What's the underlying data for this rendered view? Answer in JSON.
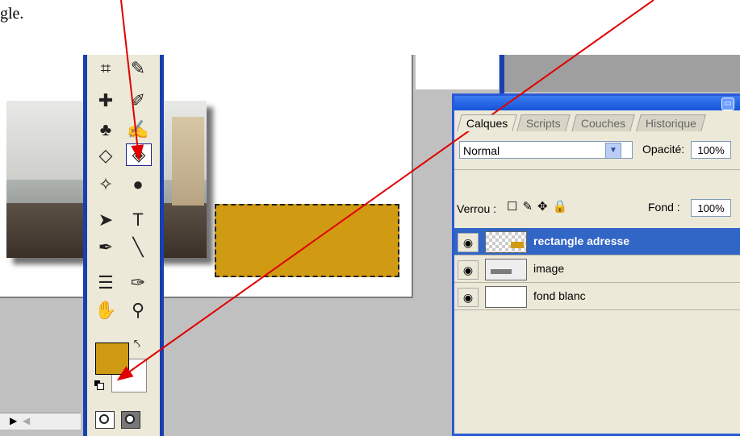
{
  "intro_text": "gle.",
  "colors": {
    "foreground": "#d09a12",
    "background": "#ffffff",
    "panel_blue": "#2a5ad7",
    "selected_layer": "#3165c6",
    "annotation_arrow": "#e00000"
  },
  "toolbox": {
    "tools": [
      "crop-icon",
      "slice-icon",
      "healing-brush-icon",
      "brush-icon",
      "clone-stamp-icon",
      "history-brush-icon",
      "eraser-icon",
      "paint-bucket-icon",
      "blur-icon",
      "dodge-icon",
      "path-selection-icon",
      "type-icon",
      "pen-icon",
      "line-icon",
      "notes-icon",
      "eyedropper-icon",
      "hand-icon",
      "zoom-icon"
    ],
    "active_tool": "paint-bucket-icon",
    "type_tool_glyph": "T"
  },
  "layers_panel": {
    "tabs": [
      {
        "label": "Calques",
        "active": true
      },
      {
        "label": "Scripts",
        "active": false
      },
      {
        "label": "Couches",
        "active": false
      },
      {
        "label": "Historique",
        "active": false
      }
    ],
    "blend_mode": "Normal",
    "opacity_label": "Opacité:",
    "opacity_value": "100%",
    "lock_label": "Verrou :",
    "fill_label": "Fond :",
    "fill_value": "100%",
    "layers": [
      {
        "name": "rectangle adresse",
        "selected": true,
        "visible": true
      },
      {
        "name": "image",
        "selected": false,
        "visible": true
      },
      {
        "name": "fond blanc",
        "selected": false,
        "visible": true
      }
    ]
  }
}
